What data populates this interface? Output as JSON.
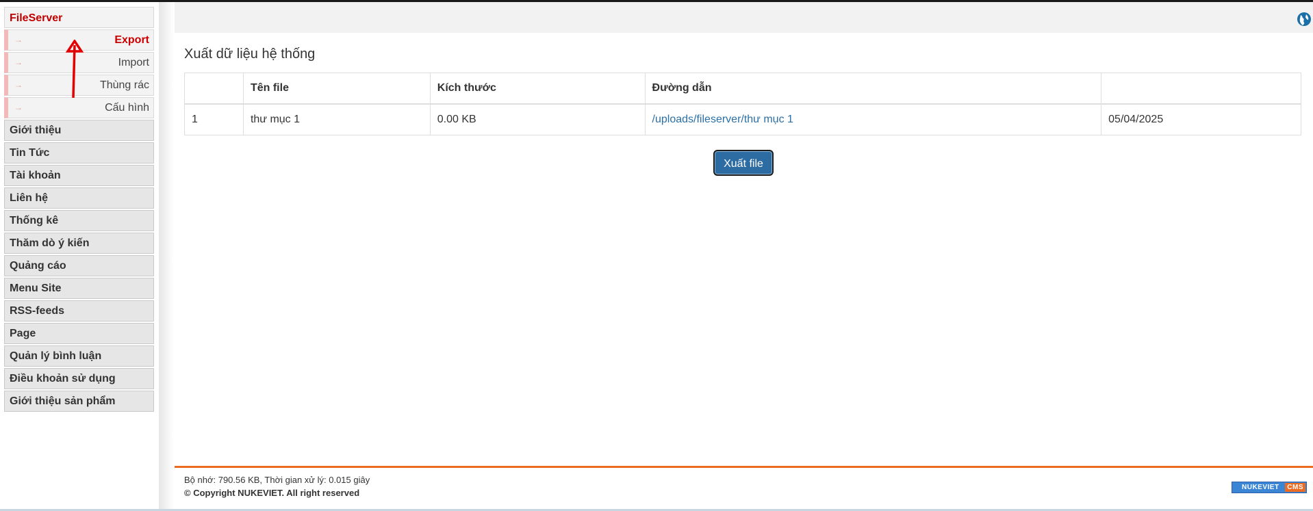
{
  "sidebar": {
    "title": "FileServer",
    "sub_items": [
      {
        "label": "Export",
        "active": true
      },
      {
        "label": "Import",
        "active": false
      },
      {
        "label": "Thùng rác",
        "active": false
      },
      {
        "label": "Cấu hình",
        "active": false
      }
    ],
    "items": [
      "Giới thiệu",
      "Tin Tức",
      "Tài khoản",
      "Liên hệ",
      "Thống kê",
      "Thăm dò ý kiến",
      "Quảng cáo",
      "Menu Site",
      "RSS-feeds",
      "Page",
      "Quản lý bình luận",
      "Điều khoản sử dụng",
      "Giới thiệu sản phẩm"
    ],
    "sub_arrow_glyph": "→"
  },
  "header": {
    "globe_icon": "globe-icon"
  },
  "main": {
    "heading": "Xuất dữ liệu hệ thống",
    "table": {
      "headers": [
        "",
        "Tên file",
        "Kích thước",
        "Đường dẫn",
        ""
      ],
      "rows": [
        [
          "1",
          "thư mục 1",
          "0.00 KB",
          "/uploads/fileserver/thư mục 1",
          "05/04/2025"
        ]
      ]
    },
    "export_button": "Xuất file"
  },
  "footer": {
    "stats": "Bộ nhớ: 790.56 KB, Thời gian xử lý: 0.015 giây",
    "copyright": "© Copyright NUKEVIET. All right reserved",
    "logo_text": "NUKEVIET",
    "logo_badge": "CMS"
  },
  "colors": {
    "accent_red": "#c00000",
    "link_blue": "#2a70a6",
    "button_blue": "#2d6ca2",
    "footer_orange": "#ec6b22"
  }
}
